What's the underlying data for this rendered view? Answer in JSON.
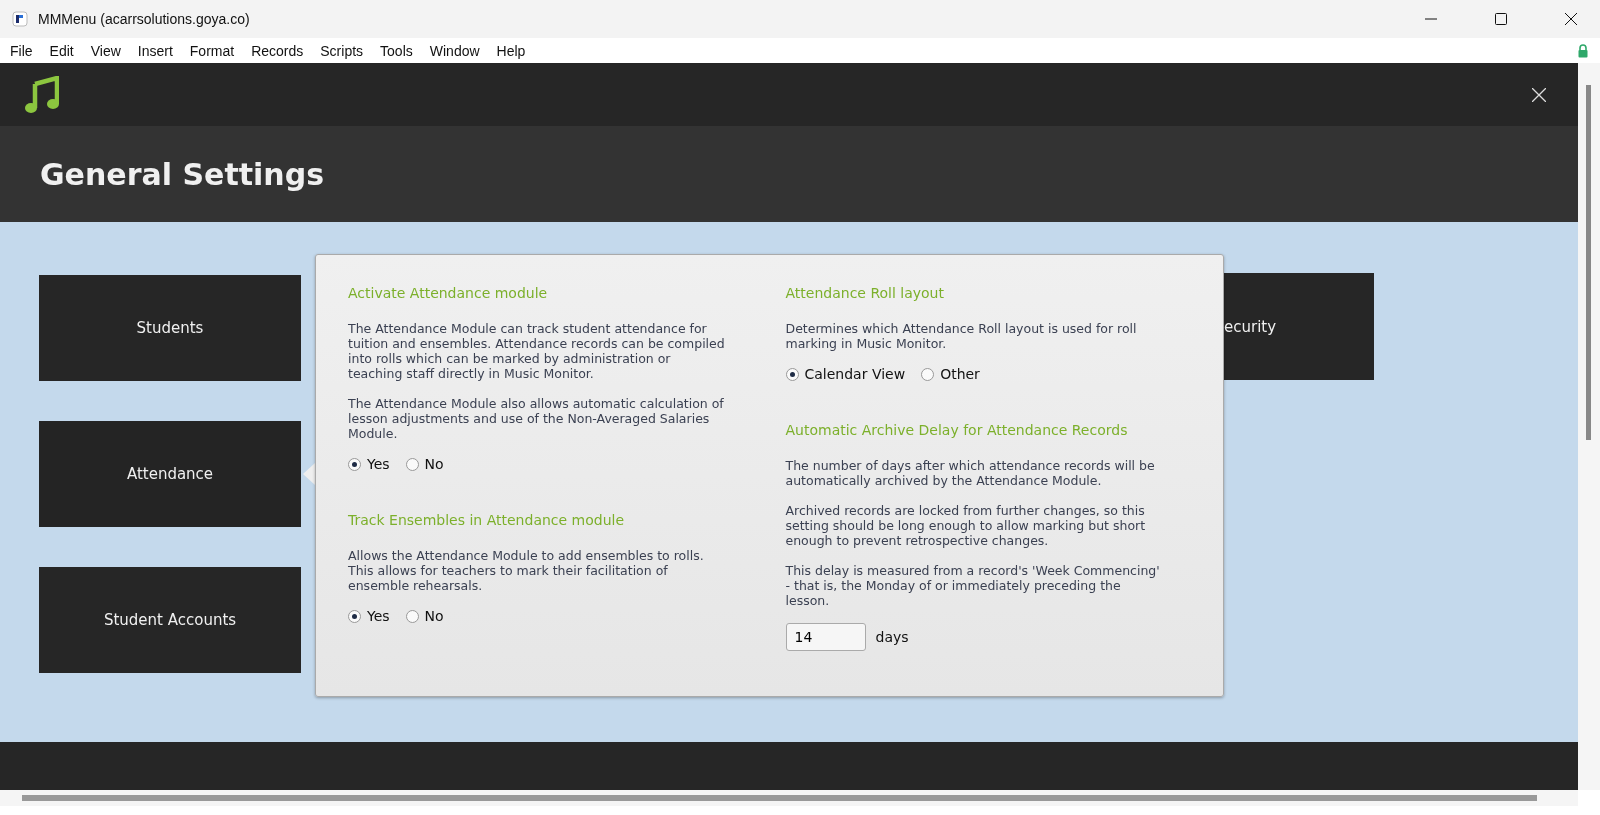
{
  "window": {
    "title": "MMMenu (acarrsolutions.goya.co)"
  },
  "menu": [
    "File",
    "Edit",
    "View",
    "Insert",
    "Format",
    "Records",
    "Scripts",
    "Tools",
    "Window",
    "Help"
  ],
  "page_title": "General Settings",
  "tiles": [
    {
      "label": "Students",
      "selected": false
    },
    {
      "label": "Attendance",
      "selected": true
    },
    {
      "label": "Student Accounts",
      "selected": false
    }
  ],
  "right_tile": {
    "label": "ecurity"
  },
  "panel": {
    "left": [
      {
        "heading": "Activate Attendance module",
        "paragraphs": [
          "The Attendance Module can track student attendance for tuition and ensembles. Attendance records can be compiled into rolls which can be marked by administration or teaching staff directly in Music Monitor.",
          "The Attendance Module also allows automatic calculation of lesson adjustments and use of the Non-Averaged Salaries Module."
        ],
        "options": [
          {
            "label": "Yes",
            "selected": true
          },
          {
            "label": "No",
            "selected": false
          }
        ]
      },
      {
        "heading": "Track Ensembles in Attendance module",
        "paragraphs": [
          "Allows the Attendance Module to add ensembles to rolls. This allows for teachers to mark their facilitation of ensemble rehearsals."
        ],
        "options": [
          {
            "label": "Yes",
            "selected": true
          },
          {
            "label": "No",
            "selected": false
          }
        ]
      }
    ],
    "right": [
      {
        "heading": "Attendance Roll layout",
        "paragraphs": [
          "Determines which Attendance Roll layout is used for roll marking in Music Monitor."
        ],
        "options": [
          {
            "label": "Calendar View",
            "selected": true
          },
          {
            "label": "Other",
            "selected": false
          }
        ]
      },
      {
        "heading": "Automatic Archive Delay for Attendance Records",
        "paragraphs": [
          "The number of days after which attendance records will be automatically archived by the Attendance Module.",
          "Archived records are locked from further changes, so this setting should be long enough to allow marking but short enough to prevent retrospective changes.",
          "This delay is measured from a record's 'Week Commencing' - that is, the Monday of or immediately preceding the lesson."
        ],
        "field": {
          "value": "14",
          "unit": "days"
        }
      }
    ]
  }
}
